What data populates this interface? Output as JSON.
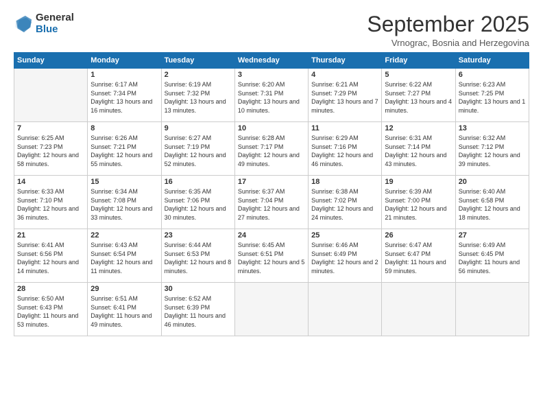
{
  "logo": {
    "general": "General",
    "blue": "Blue"
  },
  "header": {
    "title": "September 2025",
    "subtitle": "Vrnograc, Bosnia and Herzegovina"
  },
  "weekdays": [
    "Sunday",
    "Monday",
    "Tuesday",
    "Wednesday",
    "Thursday",
    "Friday",
    "Saturday"
  ],
  "weeks": [
    [
      {
        "day": "",
        "sunrise": "",
        "sunset": "",
        "daylight": "",
        "empty": true
      },
      {
        "day": "1",
        "sunrise": "Sunrise: 6:17 AM",
        "sunset": "Sunset: 7:34 PM",
        "daylight": "Daylight: 13 hours and 16 minutes."
      },
      {
        "day": "2",
        "sunrise": "Sunrise: 6:19 AM",
        "sunset": "Sunset: 7:32 PM",
        "daylight": "Daylight: 13 hours and 13 minutes."
      },
      {
        "day": "3",
        "sunrise": "Sunrise: 6:20 AM",
        "sunset": "Sunset: 7:31 PM",
        "daylight": "Daylight: 13 hours and 10 minutes."
      },
      {
        "day": "4",
        "sunrise": "Sunrise: 6:21 AM",
        "sunset": "Sunset: 7:29 PM",
        "daylight": "Daylight: 13 hours and 7 minutes."
      },
      {
        "day": "5",
        "sunrise": "Sunrise: 6:22 AM",
        "sunset": "Sunset: 7:27 PM",
        "daylight": "Daylight: 13 hours and 4 minutes."
      },
      {
        "day": "6",
        "sunrise": "Sunrise: 6:23 AM",
        "sunset": "Sunset: 7:25 PM",
        "daylight": "Daylight: 13 hours and 1 minute."
      }
    ],
    [
      {
        "day": "7",
        "sunrise": "Sunrise: 6:25 AM",
        "sunset": "Sunset: 7:23 PM",
        "daylight": "Daylight: 12 hours and 58 minutes."
      },
      {
        "day": "8",
        "sunrise": "Sunrise: 6:26 AM",
        "sunset": "Sunset: 7:21 PM",
        "daylight": "Daylight: 12 hours and 55 minutes."
      },
      {
        "day": "9",
        "sunrise": "Sunrise: 6:27 AM",
        "sunset": "Sunset: 7:19 PM",
        "daylight": "Daylight: 12 hours and 52 minutes."
      },
      {
        "day": "10",
        "sunrise": "Sunrise: 6:28 AM",
        "sunset": "Sunset: 7:17 PM",
        "daylight": "Daylight: 12 hours and 49 minutes."
      },
      {
        "day": "11",
        "sunrise": "Sunrise: 6:29 AM",
        "sunset": "Sunset: 7:16 PM",
        "daylight": "Daylight: 12 hours and 46 minutes."
      },
      {
        "day": "12",
        "sunrise": "Sunrise: 6:31 AM",
        "sunset": "Sunset: 7:14 PM",
        "daylight": "Daylight: 12 hours and 43 minutes."
      },
      {
        "day": "13",
        "sunrise": "Sunrise: 6:32 AM",
        "sunset": "Sunset: 7:12 PM",
        "daylight": "Daylight: 12 hours and 39 minutes."
      }
    ],
    [
      {
        "day": "14",
        "sunrise": "Sunrise: 6:33 AM",
        "sunset": "Sunset: 7:10 PM",
        "daylight": "Daylight: 12 hours and 36 minutes."
      },
      {
        "day": "15",
        "sunrise": "Sunrise: 6:34 AM",
        "sunset": "Sunset: 7:08 PM",
        "daylight": "Daylight: 12 hours and 33 minutes."
      },
      {
        "day": "16",
        "sunrise": "Sunrise: 6:35 AM",
        "sunset": "Sunset: 7:06 PM",
        "daylight": "Daylight: 12 hours and 30 minutes."
      },
      {
        "day": "17",
        "sunrise": "Sunrise: 6:37 AM",
        "sunset": "Sunset: 7:04 PM",
        "daylight": "Daylight: 12 hours and 27 minutes."
      },
      {
        "day": "18",
        "sunrise": "Sunrise: 6:38 AM",
        "sunset": "Sunset: 7:02 PM",
        "daylight": "Daylight: 12 hours and 24 minutes."
      },
      {
        "day": "19",
        "sunrise": "Sunrise: 6:39 AM",
        "sunset": "Sunset: 7:00 PM",
        "daylight": "Daylight: 12 hours and 21 minutes."
      },
      {
        "day": "20",
        "sunrise": "Sunrise: 6:40 AM",
        "sunset": "Sunset: 6:58 PM",
        "daylight": "Daylight: 12 hours and 18 minutes."
      }
    ],
    [
      {
        "day": "21",
        "sunrise": "Sunrise: 6:41 AM",
        "sunset": "Sunset: 6:56 PM",
        "daylight": "Daylight: 12 hours and 14 minutes."
      },
      {
        "day": "22",
        "sunrise": "Sunrise: 6:43 AM",
        "sunset": "Sunset: 6:54 PM",
        "daylight": "Daylight: 12 hours and 11 minutes."
      },
      {
        "day": "23",
        "sunrise": "Sunrise: 6:44 AM",
        "sunset": "Sunset: 6:53 PM",
        "daylight": "Daylight: 12 hours and 8 minutes."
      },
      {
        "day": "24",
        "sunrise": "Sunrise: 6:45 AM",
        "sunset": "Sunset: 6:51 PM",
        "daylight": "Daylight: 12 hours and 5 minutes."
      },
      {
        "day": "25",
        "sunrise": "Sunrise: 6:46 AM",
        "sunset": "Sunset: 6:49 PM",
        "daylight": "Daylight: 12 hours and 2 minutes."
      },
      {
        "day": "26",
        "sunrise": "Sunrise: 6:47 AM",
        "sunset": "Sunset: 6:47 PM",
        "daylight": "Daylight: 11 hours and 59 minutes."
      },
      {
        "day": "27",
        "sunrise": "Sunrise: 6:49 AM",
        "sunset": "Sunset: 6:45 PM",
        "daylight": "Daylight: 11 hours and 56 minutes."
      }
    ],
    [
      {
        "day": "28",
        "sunrise": "Sunrise: 6:50 AM",
        "sunset": "Sunset: 6:43 PM",
        "daylight": "Daylight: 11 hours and 53 minutes."
      },
      {
        "day": "29",
        "sunrise": "Sunrise: 6:51 AM",
        "sunset": "Sunset: 6:41 PM",
        "daylight": "Daylight: 11 hours and 49 minutes."
      },
      {
        "day": "30",
        "sunrise": "Sunrise: 6:52 AM",
        "sunset": "Sunset: 6:39 PM",
        "daylight": "Daylight: 11 hours and 46 minutes."
      },
      {
        "day": "",
        "sunrise": "",
        "sunset": "",
        "daylight": "",
        "empty": true
      },
      {
        "day": "",
        "sunrise": "",
        "sunset": "",
        "daylight": "",
        "empty": true
      },
      {
        "day": "",
        "sunrise": "",
        "sunset": "",
        "daylight": "",
        "empty": true
      },
      {
        "day": "",
        "sunrise": "",
        "sunset": "",
        "daylight": "",
        "empty": true
      }
    ]
  ]
}
